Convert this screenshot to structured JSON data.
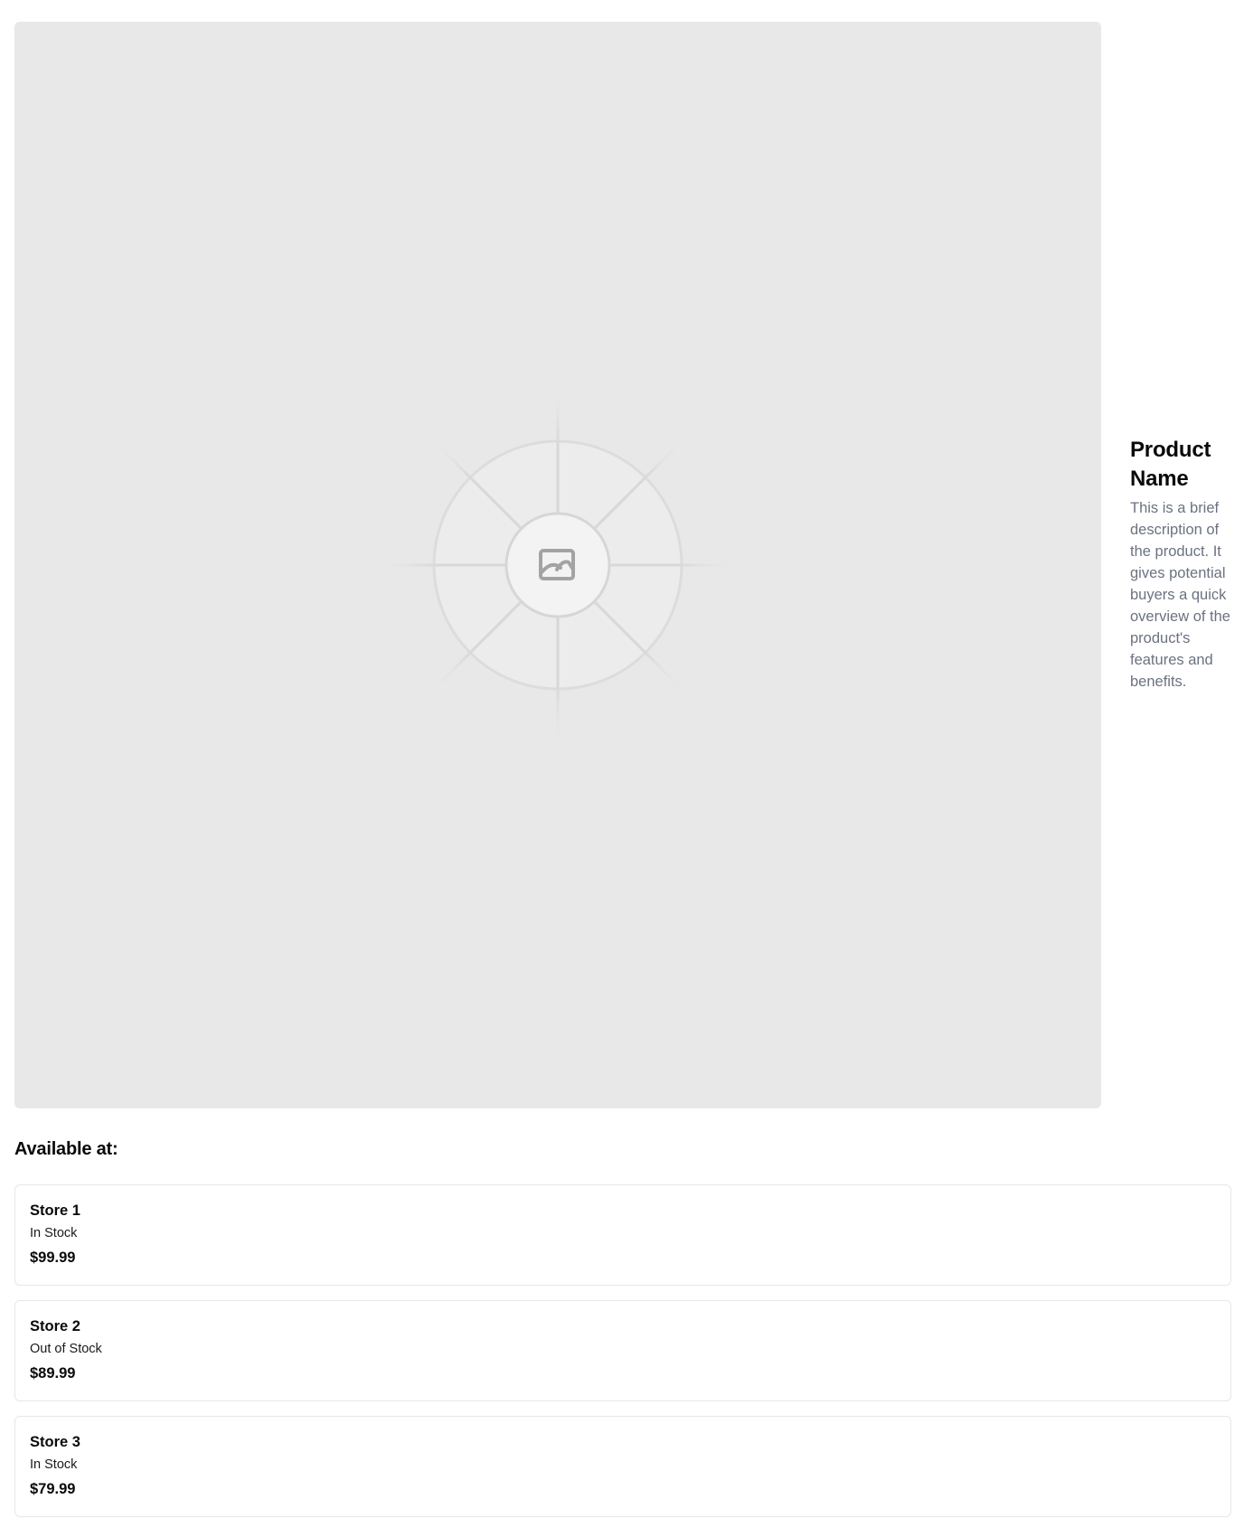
{
  "product": {
    "name": "Product Name",
    "description": "This is a brief description of the product. It gives potential buyers a quick overview of the product's features and benefits.",
    "image_icon": "image-placeholder-icon"
  },
  "availability": {
    "title": "Available at:",
    "stores": [
      {
        "name": "Store 1",
        "status": "In Stock",
        "price": "$99.99"
      },
      {
        "name": "Store 2",
        "status": "Out of Stock",
        "price": "$89.99"
      },
      {
        "name": "Store 3",
        "status": "In Stock",
        "price": "$79.99"
      }
    ]
  },
  "colors": {
    "image_bg": "#e8e8e8",
    "description_text": "#6b7280",
    "card_border": "#e5e7eb"
  }
}
